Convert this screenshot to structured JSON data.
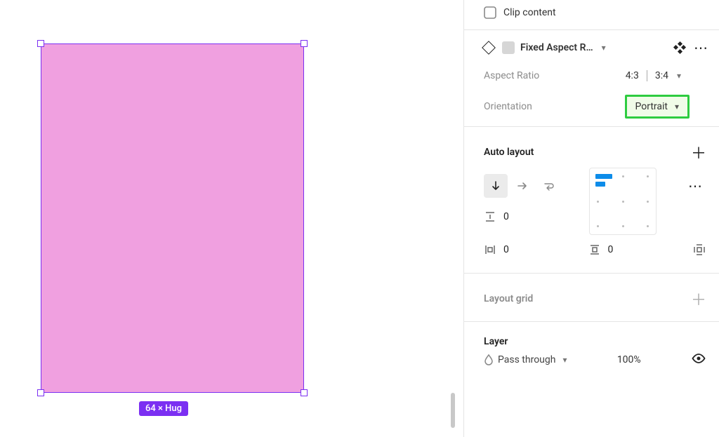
{
  "canvas": {
    "selection_badge": "64 × Hug"
  },
  "clip_content": {
    "label": "Clip content"
  },
  "component": {
    "name": "Fixed Aspect R…",
    "aspect_ratio_label": "Aspect Ratio",
    "ratio_a": "4:3",
    "ratio_b": "3:4",
    "orientation_label": "Orientation",
    "orientation_value": "Portrait"
  },
  "auto_layout": {
    "title": "Auto layout",
    "gap_value": "0",
    "padding_h_value": "0",
    "padding_v_value": "0"
  },
  "layout_grid": {
    "title": "Layout grid"
  },
  "layer": {
    "title": "Layer",
    "blend_mode": "Pass through",
    "opacity": "100%"
  }
}
